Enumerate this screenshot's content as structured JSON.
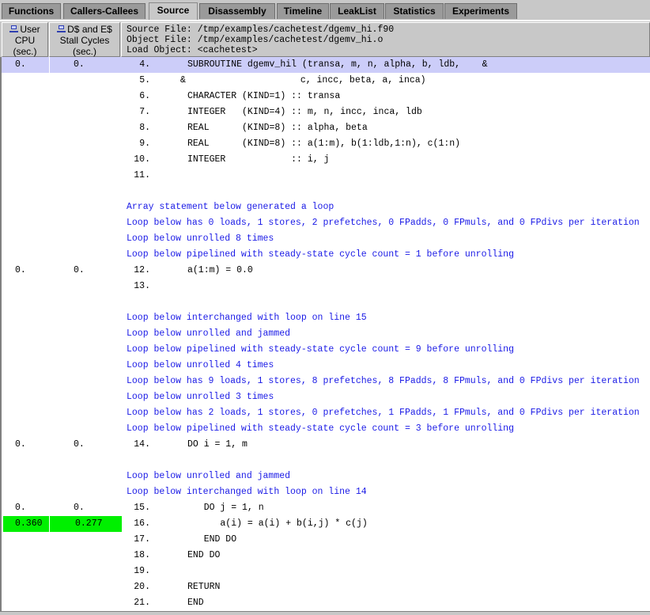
{
  "tabs": [
    {
      "label": "Functions",
      "active": false
    },
    {
      "label": "Callers-Callees",
      "active": false
    },
    {
      "label": "Source",
      "active": true
    },
    {
      "label": "Disassembly",
      "active": false
    },
    {
      "label": "Timeline",
      "active": false
    },
    {
      "label": "LeakList",
      "active": false
    },
    {
      "label": "Statistics",
      "active": false
    },
    {
      "label": "Experiments",
      "active": false
    }
  ],
  "columns": [
    {
      "icon": "metric-icon",
      "line1": "User",
      "line2": "CPU",
      "line3": "(sec.)"
    },
    {
      "icon": "metric-icon",
      "line1": "D$ and E$",
      "line2": "Stall Cycles",
      "line3": "(sec.)"
    }
  ],
  "source_header": {
    "source_file": "Source File: /tmp/examples/cachetest/dgemv_hi.f90",
    "object_file": "Object File: /tmp/examples/cachetest/dgemv_hi.o",
    "load_object": "Load Object: <cachetest>"
  },
  "colors": {
    "selected_row": "#cccdf9",
    "hot_metric": "#00f000",
    "commentary_text": "#1a1ae6"
  },
  "rows": [
    {
      "type": "code",
      "selected": true,
      "m1": "0.",
      "m2": "0.",
      "num": "4.",
      "code": "SUBROUTINE dgemv_hil (transa, m, n, alpha, b, ldb,    &"
    },
    {
      "type": "code",
      "num": "5.",
      "code": "&                     c, incc, beta, a, inca)",
      "indent": -1
    },
    {
      "type": "code",
      "num": "6.",
      "code": "CHARACTER (KIND=1) :: transa"
    },
    {
      "type": "code",
      "num": "7.",
      "code": "INTEGER   (KIND=4) :: m, n, incc, inca, ldb"
    },
    {
      "type": "code",
      "num": "8.",
      "code": "REAL      (KIND=8) :: alpha, beta"
    },
    {
      "type": "code",
      "num": "9.",
      "code": "REAL      (KIND=8) :: a(1:m), b(1:ldb,1:n), c(1:n)"
    },
    {
      "type": "code",
      "num": "10.",
      "code": "INTEGER            :: i, j"
    },
    {
      "type": "code",
      "num": "11.",
      "code": ""
    },
    {
      "type": "blank"
    },
    {
      "type": "comment",
      "text": "Array statement below generated a loop"
    },
    {
      "type": "comment",
      "text": "Loop below has 0 loads, 1 stores, 2 prefetches, 0 FPadds, 0 FPmuls, and 0 FPdivs per iteration"
    },
    {
      "type": "comment",
      "text": "Loop below unrolled 8 times"
    },
    {
      "type": "comment",
      "text": "Loop below pipelined with steady-state cycle count = 1 before unrolling"
    },
    {
      "type": "code",
      "m1": "0.",
      "m2": "0.",
      "num": "12.",
      "code": "a(1:m) = 0.0"
    },
    {
      "type": "code",
      "num": "13.",
      "code": ""
    },
    {
      "type": "blank"
    },
    {
      "type": "comment",
      "text": "Loop below interchanged with loop on line 15"
    },
    {
      "type": "comment",
      "text": "Loop below unrolled and jammed"
    },
    {
      "type": "comment",
      "text": "Loop below pipelined with steady-state cycle count = 9 before unrolling"
    },
    {
      "type": "comment",
      "text": "Loop below unrolled 4 times"
    },
    {
      "type": "comment",
      "text": "Loop below has 9 loads, 1 stores, 8 prefetches, 8 FPadds, 8 FPmuls, and 0 FPdivs per iteration"
    },
    {
      "type": "comment",
      "text": "Loop below unrolled 3 times"
    },
    {
      "type": "comment",
      "text": "Loop below has 2 loads, 1 stores, 0 prefetches, 1 FPadds, 1 FPmuls, and 0 FPdivs per iteration"
    },
    {
      "type": "comment",
      "text": "Loop below pipelined with steady-state cycle count = 3 before unrolling"
    },
    {
      "type": "code",
      "m1": "0.",
      "m2": "0.",
      "num": "14.",
      "code": "DO i = 1, m"
    },
    {
      "type": "blank"
    },
    {
      "type": "comment",
      "text": "Loop below unrolled and jammed"
    },
    {
      "type": "comment",
      "text": "Loop below interchanged with loop on line 14"
    },
    {
      "type": "code",
      "m1": "0.",
      "m2": "0.",
      "num": "15.",
      "code": "   DO j = 1, n"
    },
    {
      "type": "code",
      "hot": true,
      "m1": "0.360",
      "m2": "0.277",
      "num": "16.",
      "code": "      a(i) = a(i) + b(i,j) * c(j)"
    },
    {
      "type": "code",
      "num": "17.",
      "code": "   END DO"
    },
    {
      "type": "code",
      "num": "18.",
      "code": "END DO"
    },
    {
      "type": "code",
      "num": "19.",
      "code": ""
    },
    {
      "type": "code",
      "num": "20.",
      "code": "RETURN"
    },
    {
      "type": "code",
      "num": "21.",
      "code": "END"
    }
  ]
}
